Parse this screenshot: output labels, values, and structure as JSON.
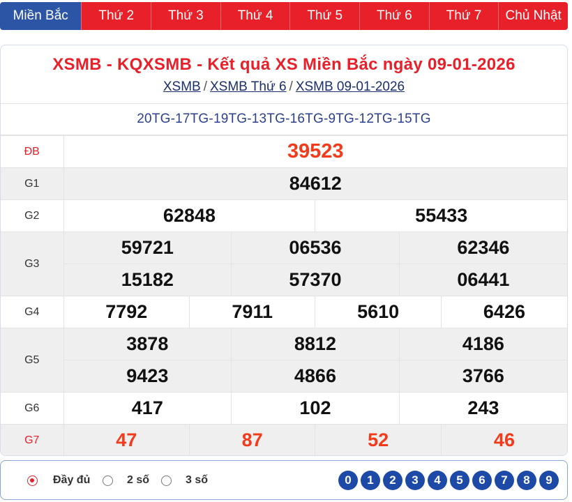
{
  "tabs": [
    "Miền Bắc",
    "Thứ 2",
    "Thứ 3",
    "Thứ 4",
    "Thứ 5",
    "Thứ 6",
    "Thứ 7",
    "Chủ Nhật"
  ],
  "header": {
    "title": "XSMB - KQXSMB - Kết quả XS Miền Bắc ngày 09-01-2026",
    "crumbs": [
      "XSMB",
      "XSMB Thứ 6",
      "XSMB 09-01-2026"
    ],
    "separator": "/"
  },
  "codes": "20TG-17TG-19TG-13TG-16TG-9TG-12TG-15TG",
  "prizes": {
    "db": {
      "label": "ĐB",
      "values": [
        "39523"
      ]
    },
    "g1": {
      "label": "G1",
      "values": [
        "84612"
      ]
    },
    "g2": {
      "label": "G2",
      "values": [
        "62848",
        "55433"
      ]
    },
    "g3": {
      "label": "G3",
      "values": [
        "59721",
        "06536",
        "62346",
        "15182",
        "57370",
        "06441"
      ]
    },
    "g4": {
      "label": "G4",
      "values": [
        "7792",
        "7911",
        "5610",
        "6426"
      ]
    },
    "g5": {
      "label": "G5",
      "values": [
        "3878",
        "8812",
        "4186",
        "9423",
        "4866",
        "3766"
      ]
    },
    "g6": {
      "label": "G6",
      "values": [
        "417",
        "102",
        "243"
      ]
    },
    "g7": {
      "label": "G7",
      "values": [
        "47",
        "87",
        "52",
        "46"
      ]
    }
  },
  "options": {
    "full": "Đầy đủ",
    "two": "2 số",
    "three": "3 số",
    "selected": "full"
  },
  "digits": [
    "0",
    "1",
    "2",
    "3",
    "4",
    "5",
    "6",
    "7",
    "8",
    "9"
  ],
  "colors": {
    "tab_red": "#e8202a",
    "tab_active": "#2c55a6",
    "prize_red": "#f33b1b",
    "digit_blue": "#1d4aa6"
  }
}
